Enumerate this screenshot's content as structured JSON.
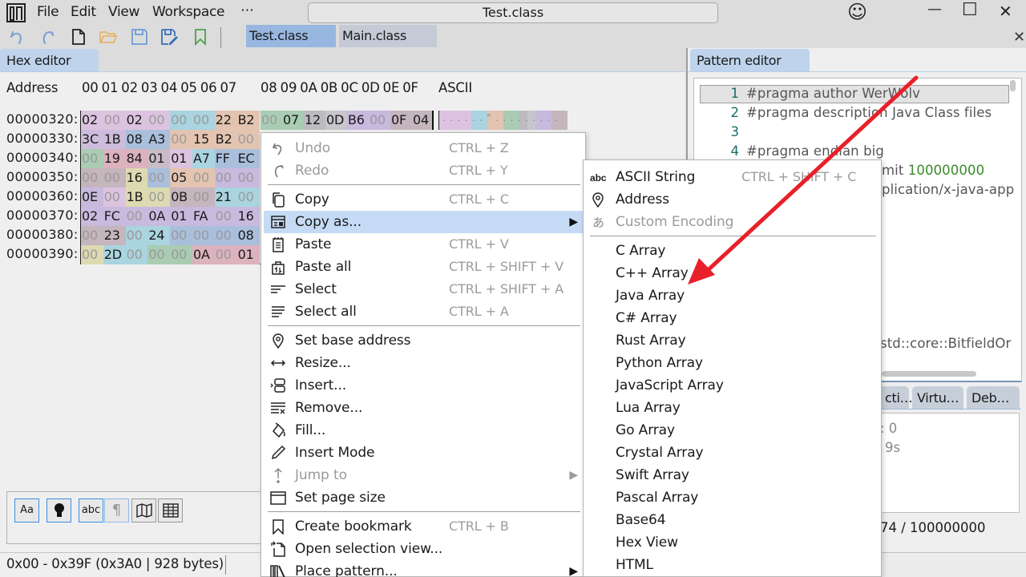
{
  "app": {
    "menu": [
      "File",
      "Edit",
      "View",
      "Workspace",
      "⋯"
    ],
    "window_title": "Test.class",
    "window_controls": {
      "minimize": "—",
      "maximize": "☐",
      "close": "✕"
    },
    "feedback_icon": "☺"
  },
  "toolbar": {
    "icons": [
      "undo-icon",
      "redo-icon",
      "new-file-icon",
      "open-folder-icon",
      "save-icon",
      "save-as-icon",
      "bookmark-icon"
    ],
    "file_tabs": [
      {
        "label": "Test.class",
        "active": true
      },
      {
        "label": "Main.class",
        "active": false
      }
    ],
    "close_all": "✕"
  },
  "hex_editor": {
    "tab_label": "Hex editor",
    "header": {
      "address_label": "Address",
      "columns_a": "00 01 02 03 04 05 06 07",
      "columns_b": "08 09 0A 0B 0C 0D 0E 0F",
      "ascii_label": "ASCII"
    },
    "rows": [
      {
        "address": "00000320:",
        "bytes": [
          "02",
          "00",
          "02",
          "00",
          "00",
          "00",
          "22",
          "B2",
          "00",
          "07",
          "12",
          "0D",
          "B6",
          "00",
          "0F",
          "04"
        ]
      },
      {
        "address": "00000330:",
        "bytes": [
          "3C",
          "1B",
          "08",
          "A3",
          "00",
          "15",
          "B2",
          "00"
        ]
      },
      {
        "address": "00000340:",
        "bytes": [
          "00",
          "19",
          "84",
          "01",
          "01",
          "A7",
          "FF",
          "EC"
        ]
      },
      {
        "address": "00000350:",
        "bytes": [
          "00",
          "00",
          "16",
          "00",
          "05",
          "00",
          "00",
          "00"
        ]
      },
      {
        "address": "00000360:",
        "bytes": [
          "0E",
          "00",
          "1B",
          "00",
          "0B",
          "00",
          "21",
          "00"
        ]
      },
      {
        "address": "00000370:",
        "bytes": [
          "02",
          "FC",
          "00",
          "0A",
          "01",
          "FA",
          "00",
          "16"
        ]
      },
      {
        "address": "00000380:",
        "bytes": [
          "00",
          "23",
          "00",
          "24",
          "00",
          "00",
          "00",
          "08"
        ]
      },
      {
        "address": "00000390:",
        "bytes": [
          "00",
          "2D",
          "00",
          "00",
          "00",
          "0A",
          "00",
          "01"
        ]
      }
    ],
    "ascii_row0": "......\".........",
    "tool_buttons": [
      "Aa",
      "●",
      "abc",
      "¶",
      "map-icon",
      "table-icon"
    ],
    "status": "0x00 - 0x39F (0x3A0 | 928 bytes)"
  },
  "context_menu": {
    "items": [
      {
        "label": "Undo",
        "shortcut": "CTRL + Z",
        "icon": "undo-icon",
        "disabled": true
      },
      {
        "label": "Redo",
        "shortcut": "CTRL + Y",
        "icon": "redo-icon",
        "disabled": true
      },
      {
        "label": "Copy",
        "shortcut": "CTRL + C",
        "icon": "copy-icon"
      },
      {
        "label": "Copy as...",
        "shortcut": "",
        "icon": "copy-as-icon",
        "submenu": true,
        "highlighted": true
      },
      {
        "label": "Paste",
        "shortcut": "CTRL + V",
        "icon": "paste-icon"
      },
      {
        "label": "Paste all",
        "shortcut": "CTRL + SHIFT + V",
        "icon": "paste-all-icon"
      },
      {
        "label": "Select",
        "shortcut": "CTRL + SHIFT + A",
        "icon": "select-icon"
      },
      {
        "label": "Select all",
        "shortcut": "CTRL + A",
        "icon": "select-all-icon"
      },
      {
        "label": "Set base address",
        "shortcut": "",
        "icon": "location-pin-icon"
      },
      {
        "label": "Resize...",
        "shortcut": "",
        "icon": "resize-icon"
      },
      {
        "label": "Insert...",
        "shortcut": "",
        "icon": "insert-icon"
      },
      {
        "label": "Remove...",
        "shortcut": "",
        "icon": "remove-icon"
      },
      {
        "label": "Fill...",
        "shortcut": "",
        "icon": "fill-bucket-icon"
      },
      {
        "label": "Insert Mode",
        "shortcut": "",
        "icon": "pencil-icon"
      },
      {
        "label": "Jump to",
        "shortcut": "",
        "icon": "jump-arrow-icon",
        "submenu": true,
        "disabled": true
      },
      {
        "label": "Set page size",
        "shortcut": "",
        "icon": "page-size-icon"
      },
      {
        "label": "Create bookmark",
        "shortcut": "CTRL + B",
        "icon": "bookmark-icon"
      },
      {
        "label": "Open selection view...",
        "shortcut": "",
        "icon": "open-view-icon"
      },
      {
        "label": "Place pattern...",
        "shortcut": "",
        "icon": "library-icon",
        "submenu": true
      }
    ]
  },
  "copy_as_submenu": {
    "items": [
      {
        "label": "ASCII String",
        "shortcut": "CTRL + SHIFT + C",
        "icon": "abc-icon"
      },
      {
        "label": "Address",
        "shortcut": "",
        "icon": "location-pin-icon"
      },
      {
        "label": "Custom Encoding",
        "shortcut": "",
        "icon": "hiragana-a-icon",
        "disabled": true
      },
      {
        "label": "C Array"
      },
      {
        "label": "C++ Array"
      },
      {
        "label": "Java Array"
      },
      {
        "label": "C# Array"
      },
      {
        "label": "Rust Array"
      },
      {
        "label": "Python Array"
      },
      {
        "label": "JavaScript Array"
      },
      {
        "label": "Lua Array"
      },
      {
        "label": "Go Array"
      },
      {
        "label": "Crystal Array"
      },
      {
        "label": "Swift Array"
      },
      {
        "label": "Pascal Array"
      },
      {
        "label": "Base64"
      },
      {
        "label": "Hex View"
      },
      {
        "label": "HTML"
      }
    ]
  },
  "pattern_editor": {
    "tab_label": "Pattern editor",
    "lines": [
      {
        "n": "1",
        "code": "#pragma author WerWolv"
      },
      {
        "n": "2",
        "code": "#pragma description Java Class files"
      },
      {
        "n": "3",
        "code": ""
      },
      {
        "n": "4",
        "code": "#pragma endian big"
      }
    ],
    "partial_lines": [
      {
        "pre": "mit ",
        "num": "100000000"
      },
      {
        "pre": "plication/x-java-app",
        "num": ""
      },
      {
        "pre": "std::core::BitfieldOr",
        "num": ""
      }
    ],
    "bottom_tabs": [
      "cti…",
      "Virtu…",
      "Deb…"
    ],
    "console_lines": [
      ": 0",
      "9s"
    ],
    "eval_count": "74 / 100000000"
  },
  "annotation": {
    "color": "#e8202a"
  }
}
